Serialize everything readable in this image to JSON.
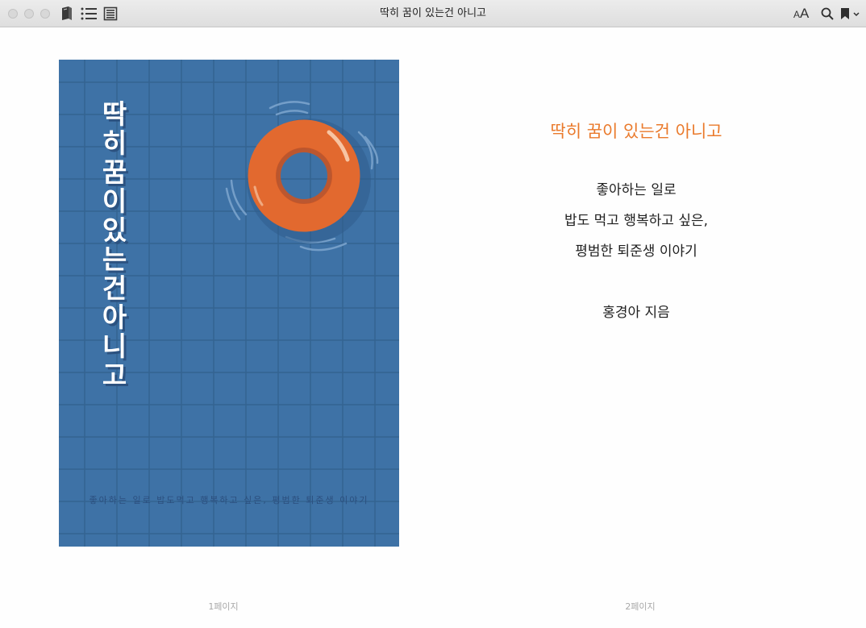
{
  "window": {
    "title": "딱히 꿈이 있는건 아니고"
  },
  "toolbar": {
    "font_size_small": "A",
    "font_size_large": "A"
  },
  "icons": {
    "library": "library-icon",
    "toc": "table-of-contents-icon",
    "notes": "notes-icon",
    "font": "font-size-icon",
    "search": "search-icon",
    "bookmark": "bookmark-icon",
    "bookmark_menu": "chevron-down-icon"
  },
  "cover": {
    "title": "딱\n히\n꿈\n이\n있\n는\n건\n아\n니\n고",
    "subtitle": "좋아하는 일로 밥도먹고 행복하고 싶은, 평범한 퇴준생 이야기",
    "background_color": "#3e72a6",
    "ring_color": "#e2692f"
  },
  "page2": {
    "title": "딱히 꿈이 있는건 아니고",
    "description_lines": [
      "좋아하는 일로",
      "밥도 먹고 행복하고 싶은,",
      "평범한 퇴준생 이야기"
    ],
    "author": "홍경아 지음",
    "title_color": "#ea7a2c"
  },
  "footer": {
    "page1_label": "1페이지",
    "page2_label": "2페이지"
  }
}
